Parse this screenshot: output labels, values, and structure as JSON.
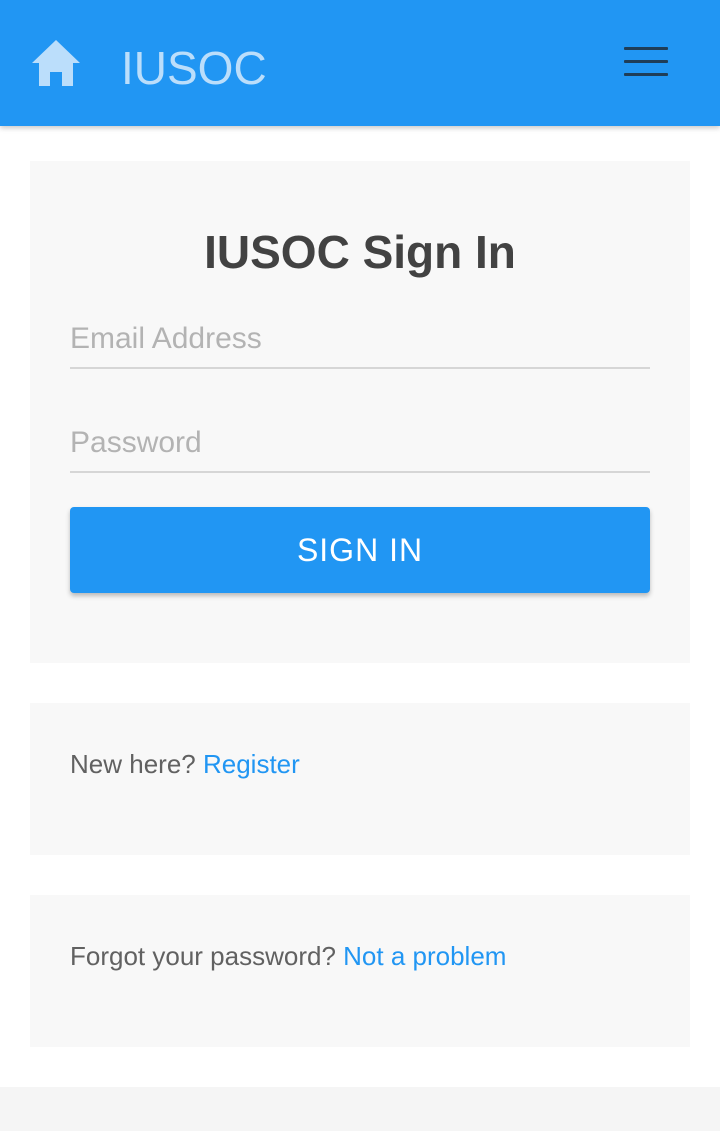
{
  "navbar": {
    "brand": "IUSOC",
    "home_icon": "home-icon",
    "menu_icon": "hamburger-menu-icon",
    "color": "#2196f3"
  },
  "signin": {
    "title": "IUSOC Sign In",
    "email_placeholder": "Email Address",
    "email_value": "",
    "password_placeholder": "Password",
    "password_value": "",
    "button_label": "SIGN IN"
  },
  "register": {
    "prompt": "New here?",
    "link": "Register"
  },
  "forgot": {
    "prompt": "Forgot your password?",
    "link": "Not a problem"
  }
}
